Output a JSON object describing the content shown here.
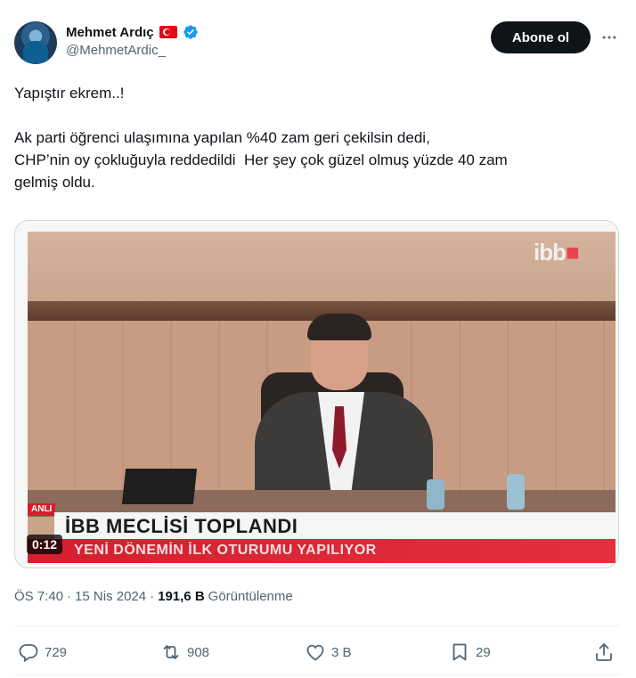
{
  "author": {
    "name": "Mehmet Ardıç",
    "handle": "@MehmetArdic_"
  },
  "follow_button": "Abone ol",
  "tweet_text": "Yapıştır ekrem..!\n\nAk parti öğrenci ulaşımına yapılan %40 zam geri çekilsin dedi,\nCHP’nin oy çokluğuyla reddedildi  Her şey çok güzel olmuş yüzde 40 zam\ngelmiş oldu.",
  "video": {
    "duration": "0:12",
    "logo_text": "ibb",
    "tag": "ANLI",
    "headline": "İBB MECLİSİ TOPLANDI",
    "subheadline": "YENİ DÖNEMİN İLK OTURUMU YAPILIYOR"
  },
  "meta": {
    "time": "ÖS 7:40",
    "separator": "·",
    "date": "15 Nis 2024",
    "separator2": "·",
    "views_count": "191,6 B",
    "views_label": "Görüntülenme"
  },
  "actions": {
    "replies": "729",
    "reposts": "908",
    "likes": "3 B",
    "bookmarks": "29"
  },
  "colors": {
    "text_primary": "#0f1419",
    "text_secondary": "#536471",
    "verified": "#1d9bf0",
    "flag_red": "#e30a17"
  },
  "icons": [
    "flag-turkey-icon",
    "verified-badge-icon",
    "more-icon",
    "reply-icon",
    "repost-icon",
    "like-icon",
    "bookmark-icon",
    "share-icon"
  ]
}
